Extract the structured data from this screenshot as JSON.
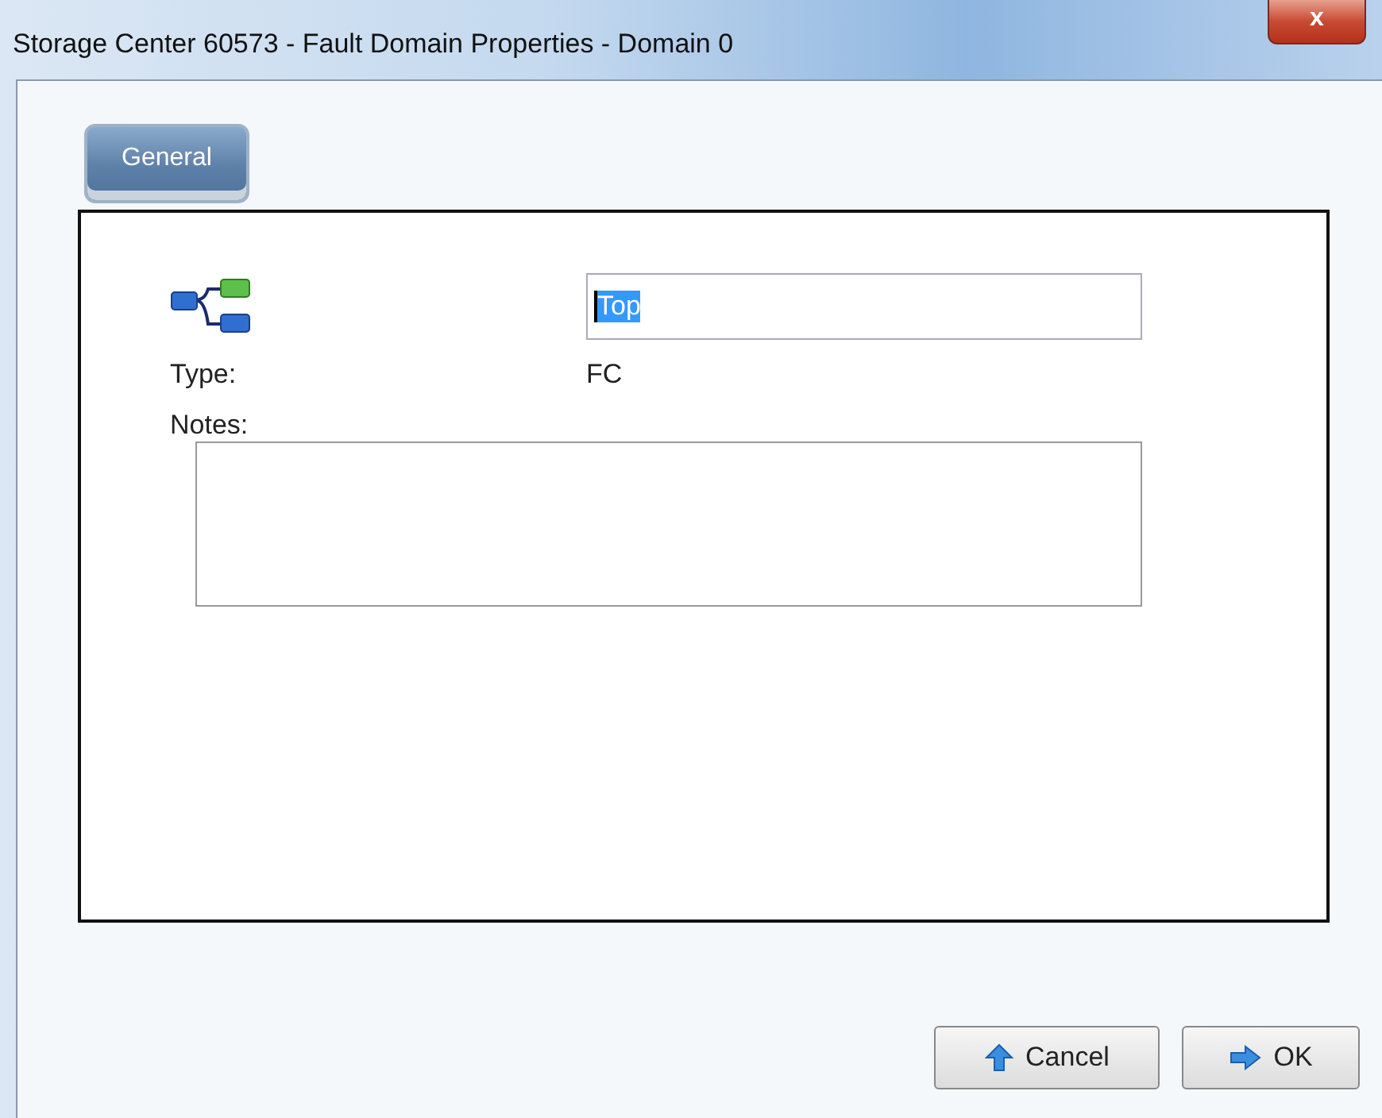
{
  "window": {
    "title": "Storage Center 60573 - Fault Domain Properties - Domain 0",
    "close": "x"
  },
  "tabs": [
    {
      "label": "General",
      "selected": true
    }
  ],
  "form": {
    "name": "Top",
    "type_label": "Type:",
    "type_value": "FC",
    "notes_label": "Notes:"
  },
  "buttons": [
    {
      "kind": "cancel",
      "label": "Cancel"
    },
    {
      "kind": "ok",
      "label": "OK"
    }
  ]
}
